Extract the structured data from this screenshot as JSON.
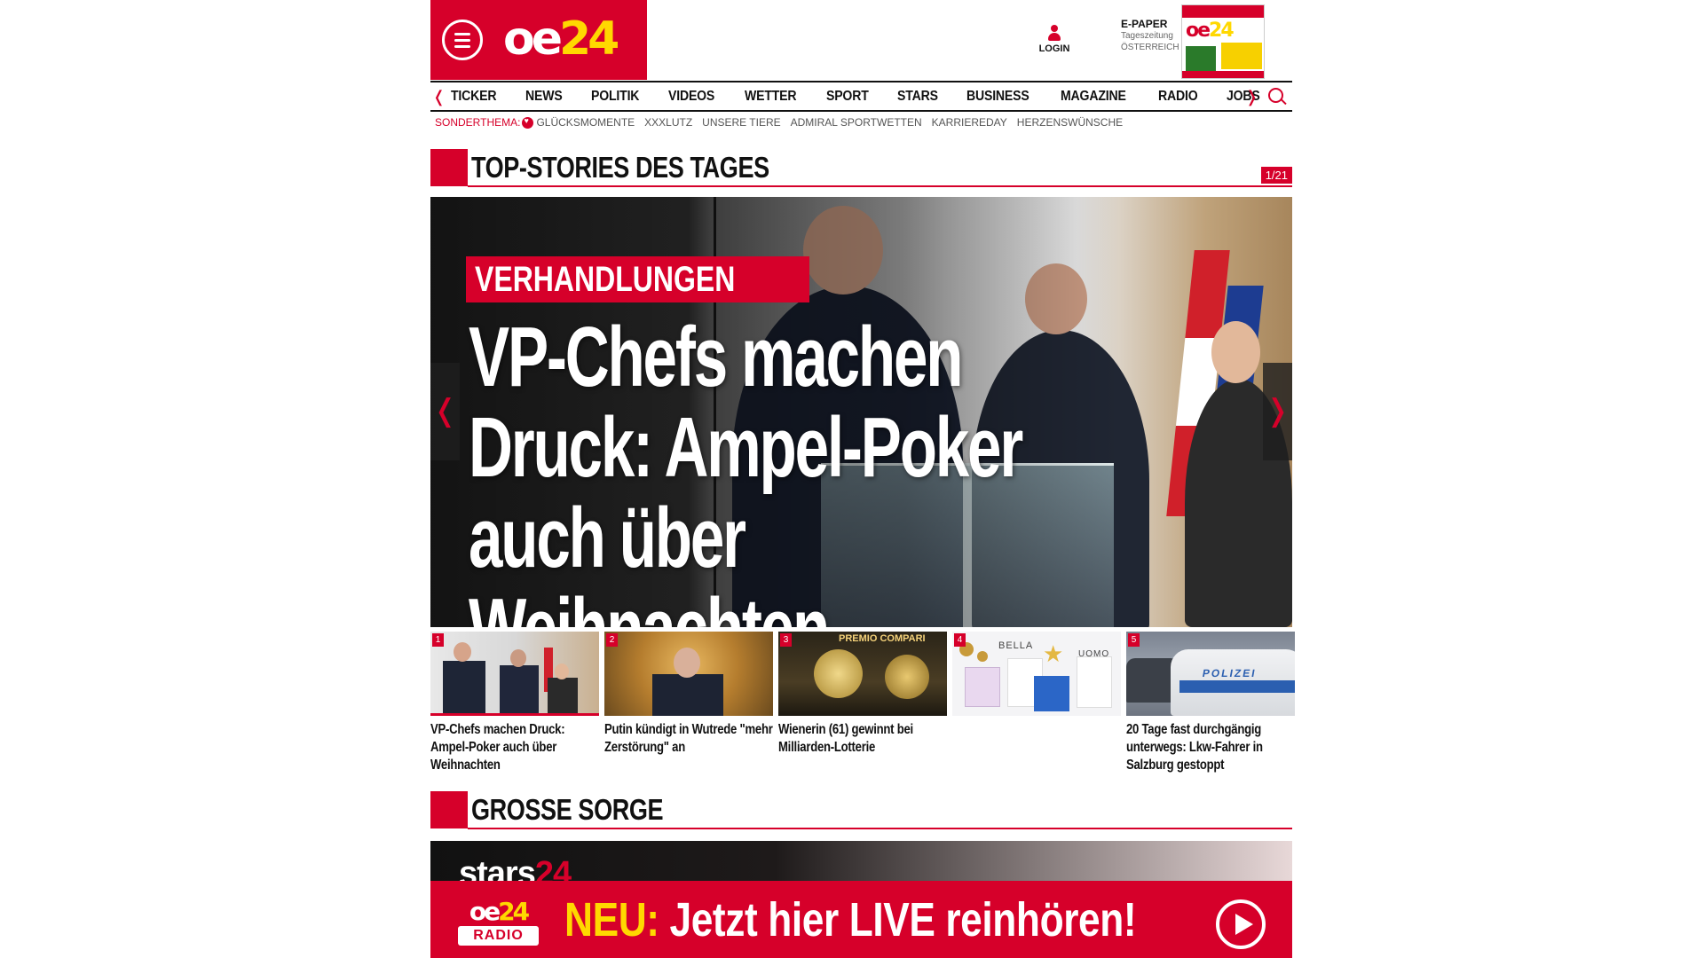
{
  "header": {
    "logo_text_a": "oe",
    "logo_text_b": "24",
    "login_label": "LOGIN",
    "epaper_title": "E-PAPER",
    "epaper_sub1": "Tageszeitung",
    "epaper_sub2": "ÖSTERREICH"
  },
  "nav": {
    "items": [
      "TICKER",
      "NEWS",
      "POLITIK",
      "VIDEOS",
      "WETTER",
      "SPORT",
      "STARS",
      "BUSINESS",
      "MAGAZINE",
      "RADIO",
      "JOBS"
    ]
  },
  "subnav": {
    "label": "SONDERTHEMA:",
    "items": [
      "GLÜCKSMOMENTE",
      "XXXLUTZ",
      "UNSERE TIERE",
      "ADMIRAL SPORTWETTEN",
      "KARRIEREDAY",
      "HERZENSWÜNSCHE"
    ]
  },
  "top_stories": {
    "title": "TOP-STORIES DES TAGES",
    "counter": "1/21",
    "hero": {
      "badge": "VERHANDLUNGEN",
      "headline": "VP-Chefs machen Druck: Ampel-Poker auch über Weihnachten"
    },
    "thumbs": [
      {
        "num": "1",
        "caption": "VP-Chefs machen Druck: Ampel-Poker auch über Weihnachten"
      },
      {
        "num": "2",
        "caption": "Putin kündigt in Wutrede \"mehr Zerstörung\" an"
      },
      {
        "num": "3",
        "caption": "Wienerin (61) gewinnt bei Milliarden-Lotterie"
      },
      {
        "num": "4",
        "caption": ""
      },
      {
        "num": "5",
        "caption": "20 Tage fast durchgängig unterwegs: Lkw-Fahrer in Salzburg gestoppt"
      }
    ],
    "thumb_texts": {
      "lottery": "PREMIO COMPARI",
      "perfume_left": "BELLA",
      "perfume_right": "UOMO",
      "police": "POLIZEI"
    }
  },
  "second_section": {
    "title": "GROSSE SORGE",
    "brand_a": "stars",
    "brand_b": "24"
  },
  "radio_banner": {
    "logo_a": "oe",
    "logo_b": "24",
    "logo_radio": "RADIO",
    "neu": "NEU:",
    "message": "Jetzt hier LIVE reinhören!"
  },
  "colors": {
    "brand_red": "#d6002a",
    "accent_yellow": "#ffd800"
  }
}
